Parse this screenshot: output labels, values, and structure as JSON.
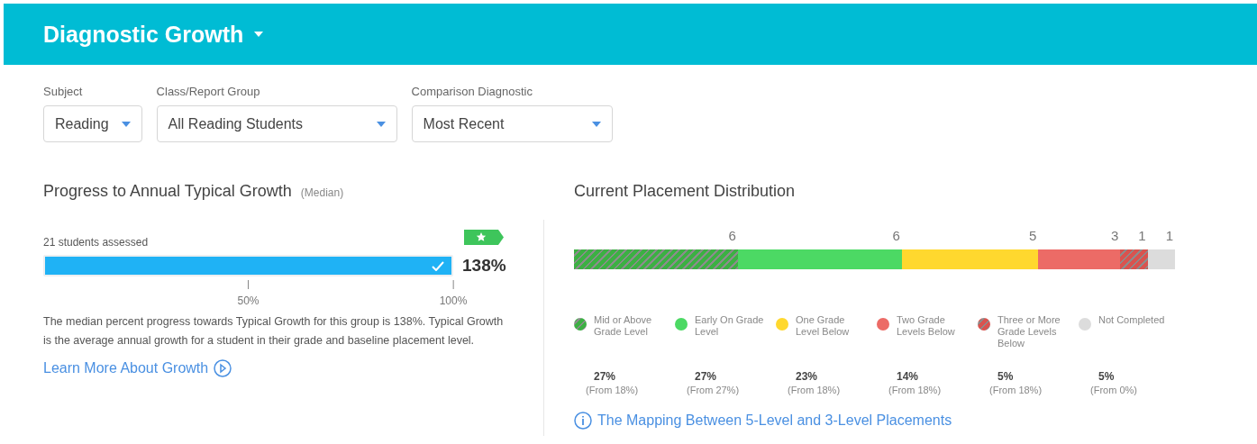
{
  "header": {
    "title": "Diagnostic Growth"
  },
  "filters": [
    {
      "label": "Subject",
      "value": "Reading"
    },
    {
      "label": "Class/Report Group",
      "value": "All Reading Students"
    },
    {
      "label": "Comparison Diagnostic",
      "value": "Most Recent"
    }
  ],
  "progress": {
    "title": "Progress to Annual Typical Growth",
    "subtitle": "(Median)",
    "assessed": "21 students assessed",
    "level": 1,
    "met_goal": true,
    "value": "138%",
    "ticks": [
      "50%",
      "100%"
    ],
    "description": "The median percent progress towards Typical Growth for this group is 138%. Typical Growth is the average annual growth for a student in their grade and baseline placement level.",
    "link": "Learn More About Growth"
  },
  "distribution": {
    "title": "Current Placement Distribution",
    "segments": [
      {
        "count": "6",
        "label": "Mid or Above Grade Level",
        "percent": "27%",
        "from": "(From 18%)",
        "color": "#3cb043",
        "kind": "hatched"
      },
      {
        "count": "6",
        "label": "Early On Grade Level",
        "percent": "27%",
        "from": "(From 27%)",
        "color": "#4cd964",
        "kind": "solid"
      },
      {
        "count": "5",
        "label": "One Grade Level Below",
        "percent": "23%",
        "from": "(From 18%)",
        "color": "#ffd82e",
        "kind": "solid"
      },
      {
        "count": "3",
        "label": "Two Grade Levels Below",
        "percent": "14%",
        "from": "(From 18%)",
        "color": "#ec6b66",
        "kind": "solid"
      },
      {
        "count": "1",
        "label": "Three or More Grade Levels Below",
        "percent": "5%",
        "from": "(From 18%)",
        "color": "#d9534f",
        "kind": "hatched"
      },
      {
        "count": "1",
        "label": "Not Completed",
        "percent": "5%",
        "from": "(From 0%)",
        "color": "#dcdcdc",
        "kind": "solid"
      }
    ],
    "link": "The Mapping Between 5-Level and 3-Level Placements"
  }
}
